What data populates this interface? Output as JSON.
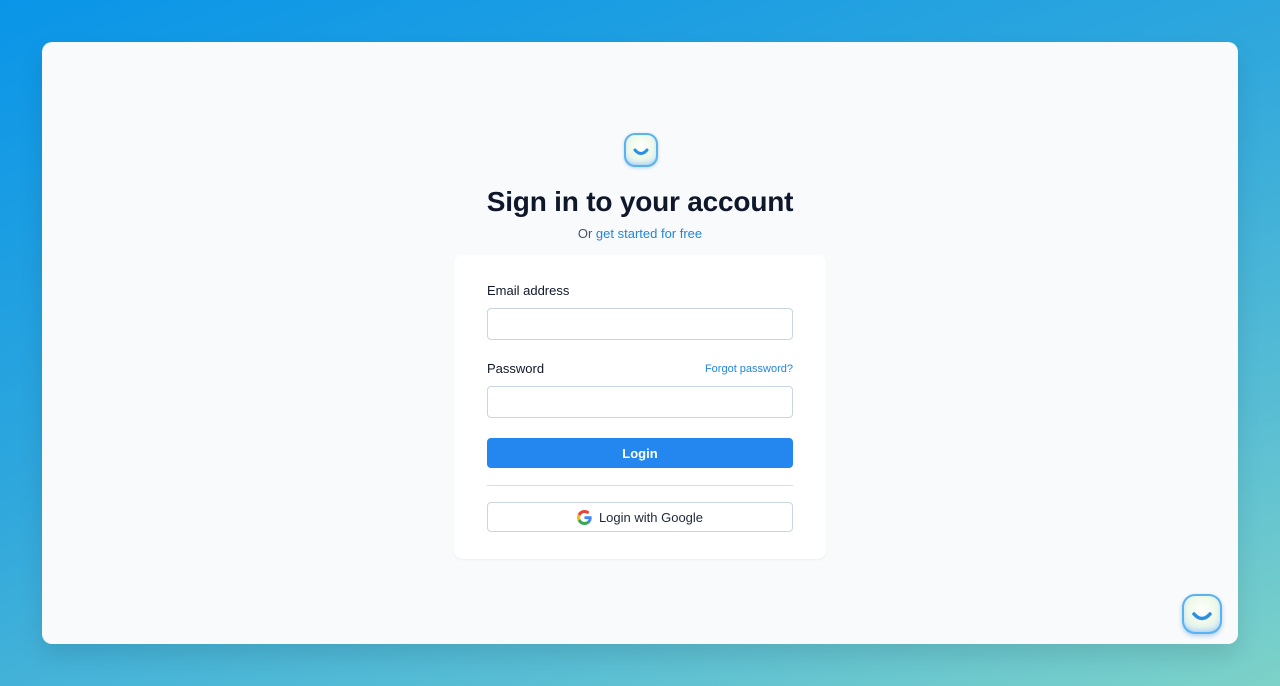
{
  "page": {
    "heading": "Sign in to your account",
    "subtitle_prefix": "Or",
    "subtitle_link": "get started for free"
  },
  "form": {
    "email_label": "Email address",
    "email_value": "",
    "email_placeholder": "",
    "password_label": "Password",
    "password_value": "",
    "password_placeholder": "",
    "forgot_link": "Forgot password?",
    "login_button": "Login",
    "google_button": "Login with Google"
  },
  "icons": {
    "brand_logo": "smiley-logo-icon",
    "google": "google-icon",
    "chat_widget": "smiley-chat-icon"
  },
  "colors": {
    "accent": "#2487f0",
    "link": "#2486d9",
    "heading": "#0f172a",
    "background_start": "#0a95e8",
    "background_end": "#7dd2c8"
  }
}
